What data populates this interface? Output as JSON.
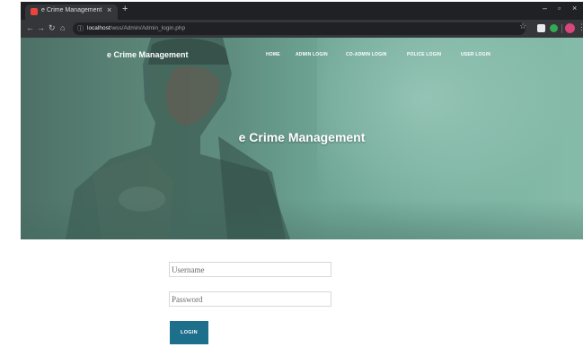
{
  "browser": {
    "tab_title": "e Crime Management",
    "tab_close": "×",
    "new_tab": "+",
    "url_host": "localhost",
    "url_path": "/wss/Admin/Admin_login.php",
    "window_controls": {
      "minimize": "–",
      "maximize": "▫",
      "close": "×"
    },
    "icons": [
      "back-icon",
      "forward-icon",
      "reload-icon",
      "home-icon",
      "lock-icon",
      "star-icon",
      "extension-icon",
      "profile-avatar",
      "menu-icon"
    ]
  },
  "header": {
    "brand": "e Crime Management",
    "nav": [
      "HOME",
      "ADMIN LOGIN",
      "CO-ADMIN LOGIN",
      "POLICE LOGIN",
      "USER LOGIN"
    ]
  },
  "hero": {
    "title": "e Crime Management"
  },
  "form": {
    "username_placeholder": "Username",
    "password_placeholder": "Password",
    "login_label": "LOGIN"
  },
  "colors": {
    "accent": "#1e6f8c",
    "hero_tint": "#6fa696",
    "chrome": "#202124"
  }
}
